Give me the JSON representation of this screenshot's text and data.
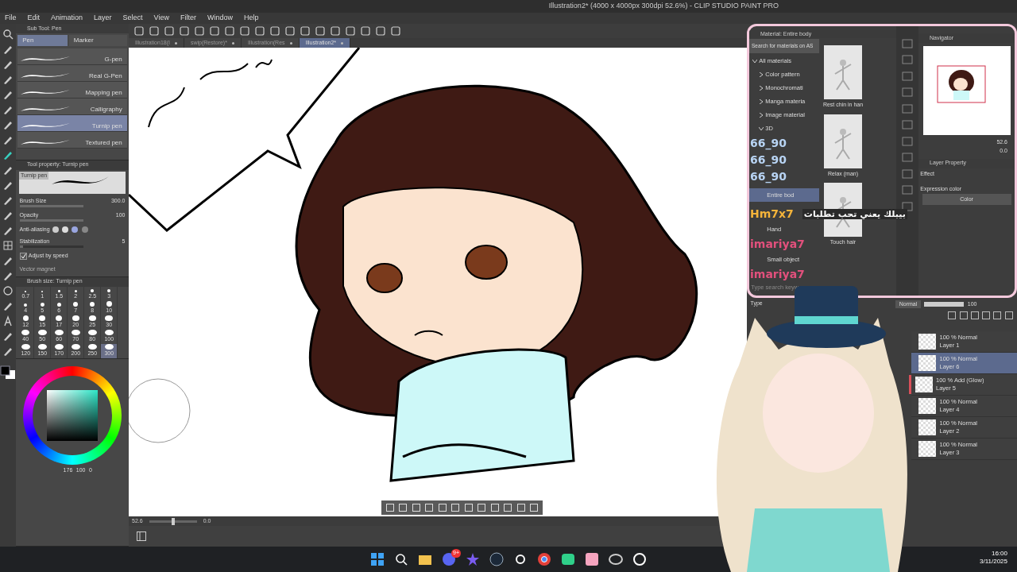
{
  "window": {
    "title": "Illustration2* (4000 x 4000px 300dpi 52.6%) - CLIP STUDIO PAINT PRO"
  },
  "menu": [
    "File",
    "Edit",
    "Animation",
    "Layer",
    "Select",
    "View",
    "Filter",
    "Window",
    "Help"
  ],
  "doc_tabs": [
    {
      "label": "Illustration18(I",
      "selected": false
    },
    {
      "label": "swip(Restore)*",
      "selected": false
    },
    {
      "label": "Illustration(Res",
      "selected": false
    },
    {
      "label": "Illustration2*",
      "selected": true
    }
  ],
  "sub_tool": {
    "title": "Sub Tool: Pen",
    "groups": [
      {
        "label": "Pen",
        "selected": true
      },
      {
        "label": "Marker",
        "selected": false
      }
    ],
    "brushes": [
      {
        "name": "G-pen",
        "selected": false
      },
      {
        "name": "Real G-Pen",
        "selected": false
      },
      {
        "name": "Mapping pen",
        "selected": false
      },
      {
        "name": "Calligraphy",
        "selected": false
      },
      {
        "name": "Turnip pen",
        "selected": true
      },
      {
        "name": "Textured pen",
        "selected": false
      }
    ]
  },
  "tool_property": {
    "title": "Tool property: Turnip pen",
    "preview_label": "Turnip pen",
    "settings": [
      {
        "kind": "slider",
        "label": "Brush Size",
        "value": "300.0",
        "level": 1
      },
      {
        "kind": "slider",
        "label": "Opacity",
        "value": "100",
        "level": 1
      },
      {
        "kind": "choice",
        "label": "Anti-aliasing"
      },
      {
        "kind": "slider",
        "label": "Stabilization",
        "value": "5",
        "level": 0.05
      },
      {
        "kind": "check",
        "label": "Adjust by speed",
        "checked": true
      },
      {
        "kind": "disabled",
        "label": "Vector magnet"
      }
    ]
  },
  "brush_size": {
    "title": "Brush size: Turnip pen",
    "sizes": [
      {
        "label": "0.7",
        "selected": false
      },
      {
        "label": "1",
        "selected": false
      },
      {
        "label": "1.5",
        "selected": false
      },
      {
        "label": "2",
        "selected": false
      },
      {
        "label": "2.5",
        "selected": false
      },
      {
        "label": "3",
        "selected": false
      },
      {
        "label": "4",
        "selected": false
      },
      {
        "label": "5",
        "selected": false
      },
      {
        "label": "6",
        "selected": false
      },
      {
        "label": "7",
        "selected": false
      },
      {
        "label": "8",
        "selected": false
      },
      {
        "label": "10",
        "selected": false
      },
      {
        "label": "12",
        "selected": false
      },
      {
        "label": "15",
        "selected": false
      },
      {
        "label": "17",
        "selected": false
      },
      {
        "label": "20",
        "selected": false
      },
      {
        "label": "25",
        "selected": false
      },
      {
        "label": "30",
        "selected": false
      },
      {
        "label": "40",
        "selected": false
      },
      {
        "label": "50",
        "selected": false
      },
      {
        "label": "60",
        "selected": false
      },
      {
        "label": "70",
        "selected": false
      },
      {
        "label": "80",
        "selected": false
      },
      {
        "label": "100",
        "selected": false
      },
      {
        "label": "120",
        "selected": false
      },
      {
        "label": "150",
        "selected": false
      },
      {
        "label": "170",
        "selected": false
      },
      {
        "label": "200",
        "selected": false
      },
      {
        "label": "250",
        "selected": false
      },
      {
        "label": "300",
        "selected": true
      }
    ]
  },
  "color_panel": {
    "readouts": [
      "176",
      "100",
      "0"
    ]
  },
  "canvas_status": {
    "zoom": "52.6",
    "zoom_slider": {
      "level": 0.5
    },
    "angle": "0.0"
  },
  "material": {
    "title": "Material: Entire body",
    "search": "Search for materials on AS",
    "tree": [
      {
        "label": "All materials",
        "expanded": true,
        "children": [
          {
            "label": "Color pattern"
          },
          {
            "label": "Monochromati"
          },
          {
            "label": "Manga materia"
          },
          {
            "label": "Image material"
          },
          {
            "label": "3D",
            "expanded": true,
            "children": [
              {
                "label": "Entire bod",
                "selected": true
              },
              {
                "label": "Hand",
                "selected": false
              },
              {
                "label": "Small object",
                "selected": false
              }
            ]
          }
        ]
      }
    ],
    "thumbnails": [
      {
        "caption": "Rest chin in han"
      },
      {
        "caption": "Relax (man)"
      },
      {
        "caption": "Touch hair"
      }
    ],
    "type_search": {
      "placeholder": "Type search keyw"
    }
  },
  "chat": [
    {
      "user": "66_90",
      "color": "#b8d4f4"
    },
    {
      "user": "66_90",
      "color": "#b8d4f4"
    },
    {
      "user": "66_90",
      "color": "#b8d4f4"
    },
    {
      "user": "Hm7x7",
      "message": "بيبلك يعني تحب تطلبات",
      "color": "#f5b43a"
    },
    {
      "user": "imariya7",
      "color": "#e2507c"
    },
    {
      "user": "imariya7",
      "color": "#e2507c"
    }
  ],
  "navigator": {
    "title": "Navigator",
    "zoom": "52.6",
    "angle": "0.0"
  },
  "layer_property": {
    "title": "Layer Property",
    "effect": "Effect",
    "expression_label": "Expression color",
    "expression_value": "Color"
  },
  "type_panel": {
    "label": "Type"
  },
  "layer_panel": {
    "blend": "Normal",
    "opacity_slider": {
      "level": 1
    },
    "opacity": "100",
    "layers": [
      {
        "mode": "100 % Normal",
        "name": "Layer 1",
        "selected": false
      },
      {
        "mode": "100 % Normal",
        "name": "Layer 6",
        "selected": true
      },
      {
        "mode": "100 % Add (Glow)",
        "name": "Layer 5",
        "selected": false,
        "color": "#d9505a"
      },
      {
        "mode": "100 % Normal",
        "name": "Layer 4",
        "selected": false
      },
      {
        "mode": "100 % Normal",
        "name": "Layer 2",
        "selected": false
      },
      {
        "mode": "100 % Normal",
        "name": "Layer 3",
        "selected": false
      }
    ]
  },
  "taskbar": {
    "discord_badge": "9+",
    "time": "16:00",
    "date": "3/11/2025"
  }
}
